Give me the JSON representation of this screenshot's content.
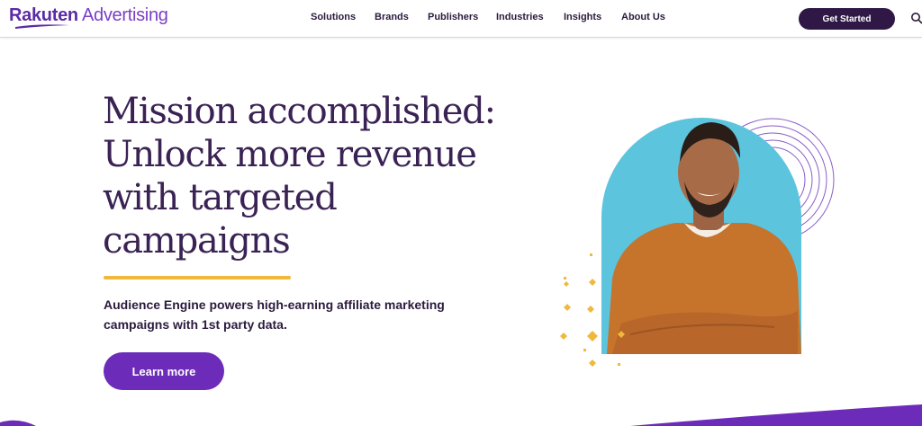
{
  "header": {
    "logo": {
      "brand": "Rakuten",
      "product": " Advertising"
    },
    "nav": [
      "Solutions",
      "Brands",
      "Publishers",
      "Industries",
      "Insights",
      "About Us"
    ],
    "cta_label": "Get Started"
  },
  "hero": {
    "headline": [
      "Mission accomplished:",
      "Unlock more revenue",
      "with targeted",
      "campaigns"
    ],
    "subtext": "Audience Engine powers high-earning affiliate marketing campaigns with 1st party data.",
    "button_label": "Learn more"
  },
  "colors": {
    "brand_purple": "#6c2bb8",
    "dark_purple": "#2f1845",
    "accent_yellow": "#f0b93c",
    "arch_blue": "#5cc4dc",
    "sweater_orange": "#c6732c"
  },
  "icons": [
    "search-icon"
  ]
}
